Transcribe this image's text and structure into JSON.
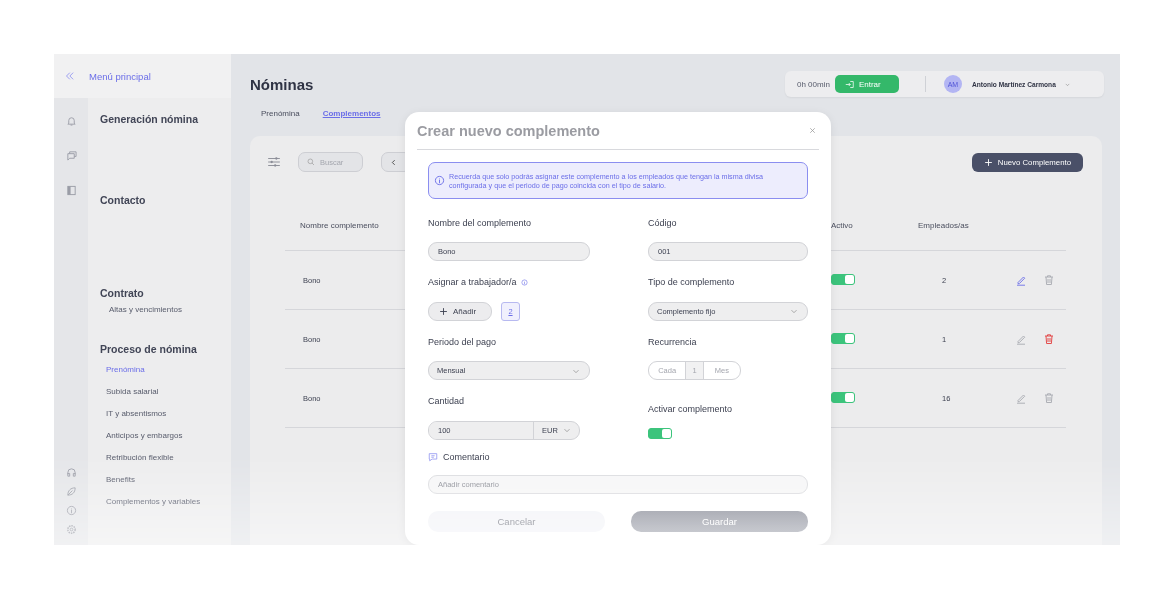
{
  "sidebar": {
    "back_label": "Menú principal",
    "sections": [
      {
        "title": "Generación nómina"
      },
      {
        "title": "Contacto"
      },
      {
        "title": "Contrato",
        "items": [
          {
            "label": "Altas y vencimientos",
            "selected": false
          }
        ]
      },
      {
        "title": "Proceso de nómina",
        "items": [
          {
            "label": "Prenómina",
            "selected": true
          },
          {
            "label": "Subida salarial",
            "selected": false
          },
          {
            "label": "IT y absentismos",
            "selected": false
          },
          {
            "label": "Anticipos y embargos",
            "selected": false
          },
          {
            "label": "Retribución flexible",
            "selected": false
          },
          {
            "label": "Benefits",
            "selected": false
          },
          {
            "label": "Complementos y variables",
            "selected": false
          }
        ]
      }
    ]
  },
  "page_title": "Nóminas",
  "header": {
    "timer": "0h 00min",
    "clock_in_button": "Entrar",
    "user_initials": "AM",
    "user_name": "Antonio Martínez Carmona"
  },
  "tabs": [
    {
      "label": "Prenómina",
      "selected": false
    },
    {
      "label": "Complementos",
      "selected": true
    }
  ],
  "toolbar": {
    "search_placeholder": "Buscar",
    "new_button": "Nuevo Complemento"
  },
  "table": {
    "columns": [
      "Nombre complemento",
      "Activo",
      "Empleados/as"
    ],
    "rows": [
      {
        "name": "Bono",
        "active": true,
        "employees": "2",
        "edit_highlighted": true,
        "delete_highlighted": false
      },
      {
        "name": "Bono",
        "active": true,
        "employees": "1",
        "edit_highlighted": false,
        "delete_highlighted": true
      },
      {
        "name": "Bono",
        "active": true,
        "employees": "16",
        "edit_highlighted": false,
        "delete_highlighted": false
      }
    ]
  },
  "modal": {
    "title": "Crear nuevo complemento",
    "notice": "Recuerda que solo podrás asignar este complemento a los empleados que tengan la misma divisa configurada y que el periodo de pago coincida con el tipo de salario.",
    "name_label": "Nombre del complemento",
    "name_value": "Bono",
    "code_label": "Código",
    "code_value": "001",
    "assign_label": "Asignar a trabajador/a",
    "add_button": "Añadir",
    "assigned_count": "2",
    "type_label": "Tipo de complemento",
    "type_value": "Complemento fijo",
    "period_label": "Periodo del pago",
    "period_value": "Mensual",
    "recurrence_label": "Recurrencia",
    "recurrence_prefix": "Cada",
    "recurrence_count": "1",
    "recurrence_unit": "Mes",
    "amount_label": "Cantidad",
    "amount_value": "100",
    "currency": "EUR",
    "activate_label": "Activar complemento",
    "activate_on": true,
    "comment_label": "Comentario",
    "comment_placeholder": "Añadir comentario",
    "cancel_button": "Cancelar",
    "save_button": "Guardar"
  }
}
